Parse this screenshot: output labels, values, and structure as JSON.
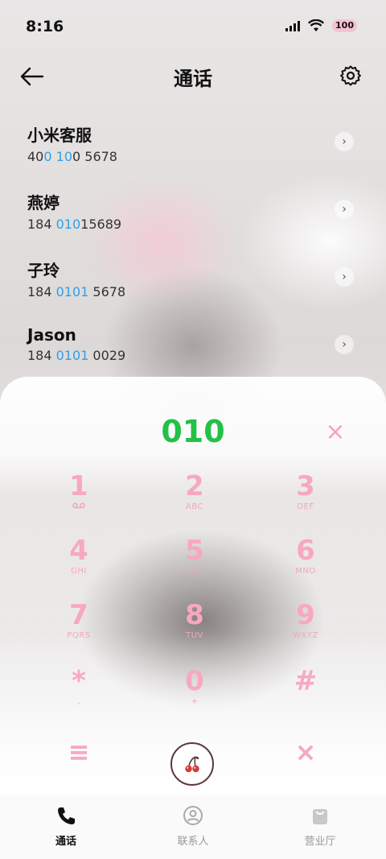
{
  "status_bar": {
    "time": "8:16",
    "battery": "100"
  },
  "header": {
    "title": "通话"
  },
  "results": [
    {
      "name": "小米客服",
      "number_parts": [
        "40",
        "0",
        " ",
        "10",
        "0 5678"
      ]
    },
    {
      "name": "燕婷",
      "number_parts": [
        "184 ",
        "010",
        "15689"
      ]
    },
    {
      "name": "子玲",
      "number_parts": [
        "184 ",
        "0101",
        " 5678"
      ]
    },
    {
      "name": "Jason",
      "number_parts": [
        "184 ",
        "0101",
        " 0029"
      ]
    }
  ],
  "dialer": {
    "input_value": "010",
    "keys": [
      {
        "digit": "1",
        "letters": ""
      },
      {
        "digit": "2",
        "letters": "ABC"
      },
      {
        "digit": "3",
        "letters": "DEF"
      },
      {
        "digit": "4",
        "letters": "GHI"
      },
      {
        "digit": "5",
        "letters": "JKL"
      },
      {
        "digit": "6",
        "letters": "MNO"
      },
      {
        "digit": "7",
        "letters": "PQRS"
      },
      {
        "digit": "8",
        "letters": "TUV"
      },
      {
        "digit": "9",
        "letters": "WXYZ"
      },
      {
        "digit": "*",
        "letters": ","
      },
      {
        "digit": "0",
        "letters": "+"
      },
      {
        "digit": "#",
        "letters": ""
      }
    ]
  },
  "bottom_nav": {
    "calls": "通话",
    "contacts": "联系人",
    "store": "营业厅"
  },
  "colors": {
    "accent_green": "#23c146",
    "highlight_blue": "#2ea0e8",
    "key_pink": "#f7a8c0"
  },
  "icons": {
    "back": "arrow-left-icon",
    "settings": "gear-icon",
    "chevron": "chevron-right-icon",
    "clear": "close-icon",
    "voicemail": "voicemail-icon",
    "menu": "menu-icon",
    "collapse": "close-icon",
    "call": "cherry-icon",
    "phone": "phone-icon",
    "contacts": "person-icon",
    "store": "bag-icon"
  }
}
